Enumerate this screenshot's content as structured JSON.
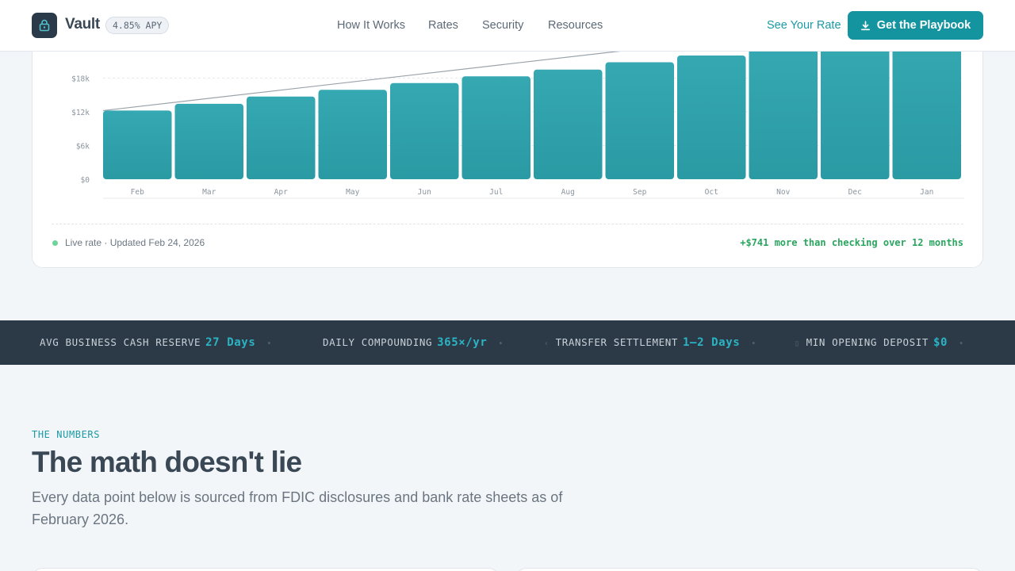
{
  "header": {
    "brand": "Vault",
    "apy_badge": "4.85% APY",
    "nav": [
      "How It Works",
      "Rates",
      "Security",
      "Resources"
    ],
    "see_rate": "See Your Rate",
    "cta": "Get the Playbook"
  },
  "chart_data": {
    "type": "bar",
    "categories": [
      "Feb",
      "Mar",
      "Apr",
      "May",
      "Jun",
      "Jul",
      "Aug",
      "Sep",
      "Oct",
      "Nov",
      "Dec",
      "Jan"
    ],
    "values": [
      9400,
      10600,
      11900,
      13100,
      14300,
      15500,
      16700,
      18000,
      19200,
      20400,
      21600,
      22800
    ],
    "y_ticks": [
      "$0",
      "$6k",
      "$12k",
      "$18k"
    ],
    "ylim": [
      0,
      24000
    ],
    "trend_line": [
      9400,
      22800
    ],
    "bar_color": "#2f9ea8"
  },
  "card": {
    "status": "Live rate · Updated Feb 24, 2026",
    "gain": "+$741 more than checking over 12 months"
  },
  "stats": [
    {
      "label": "AVG BUSINESS CASH RESERVE",
      "value": "27 Days"
    },
    {
      "label": "DAILY COMPOUNDING",
      "value": "365×/yr"
    },
    {
      "label": "TRANSFER SETTLEMENT",
      "value": "1–2 Days"
    },
    {
      "label": "MIN OPENING DEPOSIT",
      "value": "$0"
    }
  ],
  "numbers": {
    "eyebrow": "THE NUMBERS",
    "title": "The math doesn't lie",
    "subtitle": "Every data point below is sourced from FDIC disclosures and bank rate sheets as of February 2026."
  }
}
